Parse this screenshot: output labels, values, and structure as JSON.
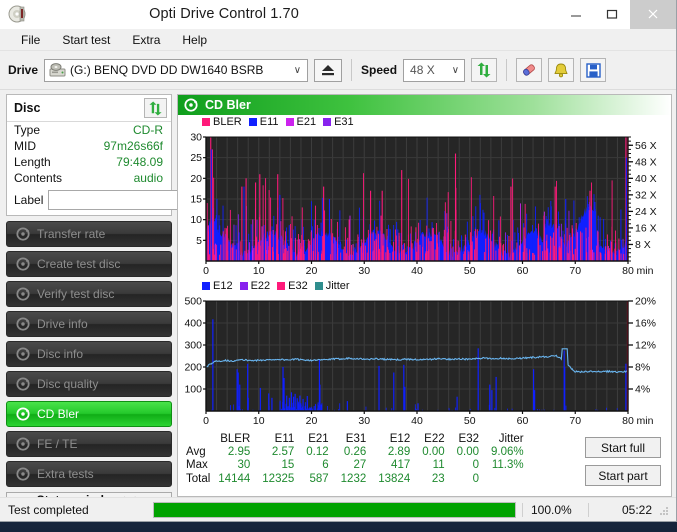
{
  "window": {
    "title": "Opti Drive Control 1.70",
    "app_icon": "disc-icon",
    "minimize": "–",
    "maximize": "□",
    "close": "✕"
  },
  "menu": {
    "items": [
      "File",
      "Start test",
      "Extra",
      "Help"
    ]
  },
  "toolbar": {
    "drive_label": "Drive",
    "drive_value": "(G:)   BENQ DVD DD DW1640 BSRB",
    "drive_chevron": "∨",
    "eject_icon": "eject-icon",
    "speed_label": "Speed",
    "speed_value": "48 X",
    "speed_chevron": "∨",
    "refresh_icon": "refresh-arrows-icon",
    "erase_icon": "eraser-icon",
    "bookmark_icon": "bell-icon",
    "save_icon": "floppy-save-icon"
  },
  "sidebar": {
    "panel_title": "Disc",
    "refresh_icon": "refresh-arrows-icon",
    "info": [
      {
        "key": "Type",
        "value": "CD-R"
      },
      {
        "key": "MID",
        "value": "97m26s66f"
      },
      {
        "key": "Length",
        "value": "79:48.09"
      },
      {
        "key": "Contents",
        "value": "audio"
      }
    ],
    "label_key": "Label",
    "label_value": "",
    "label_placeholder": "",
    "label_button_icon": "disc-icon",
    "nav": [
      {
        "label": "Transfer rate",
        "icon": "disc-icon",
        "active": false
      },
      {
        "label": "Create test disc",
        "icon": "disc-icon",
        "active": false
      },
      {
        "label": "Verify test disc",
        "icon": "disc-icon",
        "active": false
      },
      {
        "label": "Drive info",
        "icon": "disc-icon",
        "active": false
      },
      {
        "label": "Disc info",
        "icon": "disc-icon",
        "active": false
      },
      {
        "label": "Disc quality",
        "icon": "disc-icon",
        "active": false
      },
      {
        "label": "CD Bler",
        "icon": "disc-icon",
        "active": true
      },
      {
        "label": "FE / TE",
        "icon": "disc-icon",
        "active": false
      },
      {
        "label": "Extra tests",
        "icon": "disc-icon",
        "active": false
      }
    ],
    "status_window_button": "Status window > >"
  },
  "main": {
    "header_title": "CD Bler",
    "header_icon": "disc-icon",
    "start_full": "Start full",
    "start_part": "Start part"
  },
  "stats": {
    "columns": [
      "BLER",
      "E11",
      "E21",
      "E31",
      "E12",
      "E22",
      "E32",
      "Jitter"
    ],
    "rows": [
      {
        "label": "Avg",
        "values": [
          "2.95",
          "2.57",
          "0.12",
          "0.26",
          "2.89",
          "0.00",
          "0.00",
          "9.06%"
        ]
      },
      {
        "label": "Max",
        "values": [
          "30",
          "15",
          "6",
          "27",
          "417",
          "11",
          "0",
          "11.3%"
        ]
      },
      {
        "label": "Total",
        "values": [
          "14144",
          "12325",
          "587",
          "1232",
          "13824",
          "23",
          "0",
          ""
        ]
      }
    ]
  },
  "statusbar": {
    "text": "Test completed",
    "progress_percent": "100.0%",
    "progress_value": 100,
    "elapsed": "05:22",
    "grip_icon": "resize-grip-icon"
  },
  "chart_data": [
    {
      "type": "line",
      "title": "CD Bler",
      "xlabel": "min",
      "ylabel": "",
      "xlim": [
        0,
        80
      ],
      "ylim": [
        0,
        30
      ],
      "xticks": [
        0,
        10,
        20,
        30,
        40,
        50,
        60,
        70,
        80
      ],
      "xtick_labels": [
        "0",
        "10",
        "20",
        "30",
        "40",
        "50",
        "60",
        "70",
        "80"
      ],
      "yticks": [
        5,
        10,
        15,
        20,
        25,
        30
      ],
      "ytick_labels": [
        "5",
        "10",
        "15",
        "20",
        "25",
        "30"
      ],
      "y2label": "X",
      "y2ticks": [
        8,
        16,
        24,
        32,
        40,
        48,
        56
      ],
      "y2tick_labels": [
        "8 X",
        "16 X",
        "24 X",
        "32 X",
        "40 X",
        "48 X",
        "56 X"
      ],
      "y2lim": [
        0,
        60
      ],
      "grid": true,
      "legend_position": "top-left",
      "legend": [
        {
          "name": "BLER",
          "color": "#ff1a7a"
        },
        {
          "name": "E11",
          "color": "#1020ff"
        },
        {
          "name": "E21",
          "color": "#cc22ee"
        },
        {
          "name": "E31",
          "color": "#8822ee"
        }
      ],
      "series": [
        {
          "name": "BLER",
          "color": "#ff1a7a",
          "stat_avg": 2.95,
          "stat_max": 30,
          "stat_total": 14144
        },
        {
          "name": "E11",
          "color": "#1020ff",
          "stat_avg": 2.57,
          "stat_max": 15,
          "stat_total": 12325
        },
        {
          "name": "E21",
          "color": "#cc22ee",
          "stat_avg": 0.12,
          "stat_max": 6,
          "stat_total": 587
        },
        {
          "name": "E31",
          "color": "#8822ee",
          "stat_avg": 0.26,
          "stat_max": 27,
          "stat_total": 1232
        }
      ],
      "description": "Dense spiky BLER/E11 error bars across 0-80 min; blue E11 fill dominates lower band around 3-10, pink BLER spikes reach 15-30, a large spike near 0 min and at 80 min."
    },
    {
      "type": "line",
      "title": "",
      "xlabel": "min",
      "ylabel": "",
      "xlim": [
        0,
        80
      ],
      "ylim": [
        0,
        500
      ],
      "xticks": [
        0,
        10,
        20,
        30,
        40,
        50,
        60,
        70,
        80
      ],
      "xtick_labels": [
        "0",
        "10",
        "20",
        "30",
        "40",
        "50",
        "60",
        "70",
        "80"
      ],
      "yticks": [
        100,
        200,
        300,
        400,
        500
      ],
      "ytick_labels": [
        "100",
        "200",
        "300",
        "400",
        "500"
      ],
      "y2label": "%",
      "y2ticks": [
        4,
        8,
        12,
        16,
        20
      ],
      "y2tick_labels": [
        "4%",
        "8%",
        "12%",
        "16%",
        "20%"
      ],
      "y2lim": [
        0,
        20
      ],
      "grid": true,
      "legend_position": "top-left",
      "legend": [
        {
          "name": "E12",
          "color": "#1020ff"
        },
        {
          "name": "E22",
          "color": "#8822ee"
        },
        {
          "name": "E32",
          "color": "#ff1a7a"
        },
        {
          "name": "Jitter",
          "color": "#2f8e8e"
        }
      ],
      "series": [
        {
          "name": "E12",
          "color": "#1020ff",
          "stat_avg": 2.89,
          "stat_max": 417,
          "stat_total": 13824
        },
        {
          "name": "E22",
          "color": "#8822ee",
          "stat_avg": 0.0,
          "stat_max": 11,
          "stat_total": 23
        },
        {
          "name": "E32",
          "color": "#ff1a7a",
          "stat_avg": 0.0,
          "stat_max": 0,
          "stat_total": 0
        },
        {
          "name": "Jitter",
          "color": "#5aa8e8",
          "stat_avg": 9.06,
          "stat_max": 11.3,
          "unit": "%"
        }
      ],
      "jitter_trace_percent": [
        8.0,
        9.0,
        9.2,
        9.1,
        9.3,
        9.2,
        9.2,
        9.3,
        9.4,
        9.3,
        9.4,
        9.3,
        9.2,
        9.3,
        9.4,
        9.5,
        9.6,
        9.5,
        9.4,
        9.5,
        9.4,
        9.3,
        9.4,
        9.4,
        9.3,
        9.4,
        9.5,
        9.4,
        9.5,
        9.4,
        9.5,
        9.6,
        9.5,
        9.6,
        9.5,
        9.6,
        9.7,
        9.8,
        9.9,
        10.0,
        9.0,
        7.2,
        7.1,
        7.2,
        7.1,
        7.2,
        7.1,
        7.2
      ],
      "description": "Jitter trace (light blue) holds ~9% from 1 to 68 min, peaks ~11.3% at 68 min, then drops to ~7% for the last 10 minutes. Blue E12 spikes up to 417 scattered mostly before 40 min; red vertical line at 80 min."
    }
  ]
}
